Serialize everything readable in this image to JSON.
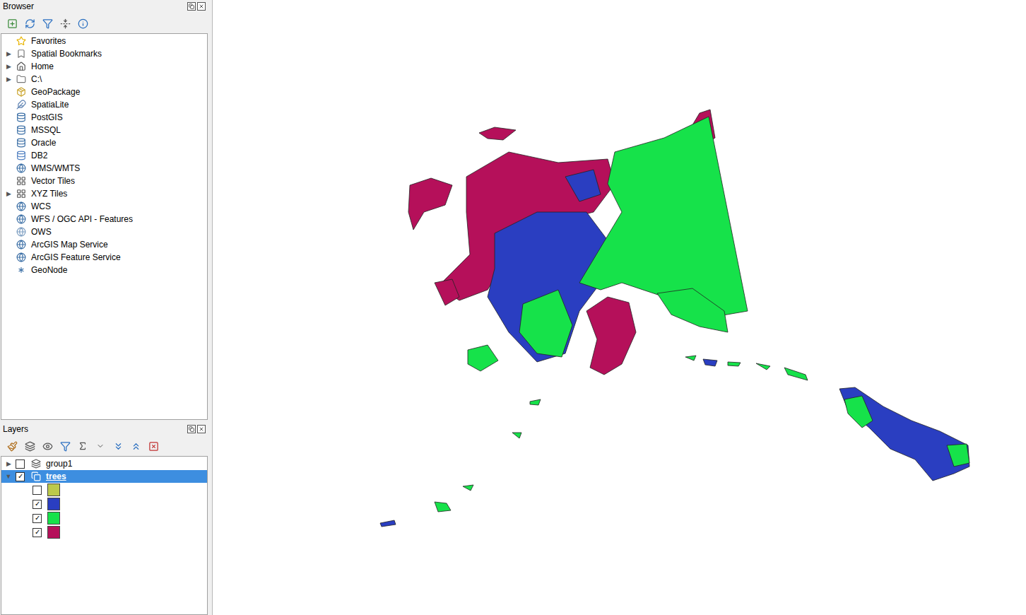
{
  "browser": {
    "title": "Browser",
    "items": [
      {
        "label": "Favorites",
        "expandable": false
      },
      {
        "label": "Spatial Bookmarks",
        "expandable": true
      },
      {
        "label": "Home",
        "expandable": true
      },
      {
        "label": "C:\\",
        "expandable": true
      },
      {
        "label": "GeoPackage",
        "expandable": false
      },
      {
        "label": "SpatiaLite",
        "expandable": false
      },
      {
        "label": "PostGIS",
        "expandable": false
      },
      {
        "label": "MSSQL",
        "expandable": false
      },
      {
        "label": "Oracle",
        "expandable": false
      },
      {
        "label": "DB2",
        "expandable": false
      },
      {
        "label": "WMS/WMTS",
        "expandable": false
      },
      {
        "label": "Vector Tiles",
        "expandable": false
      },
      {
        "label": "XYZ Tiles",
        "expandable": true
      },
      {
        "label": "WCS",
        "expandable": false
      },
      {
        "label": "WFS / OGC API - Features",
        "expandable": false
      },
      {
        "label": "OWS",
        "expandable": false
      },
      {
        "label": "ArcGIS Map Service",
        "expandable": false
      },
      {
        "label": "ArcGIS Feature Service",
        "expandable": false
      },
      {
        "label": "GeoNode",
        "expandable": false
      }
    ]
  },
  "layers_panel": {
    "title": "Layers",
    "layers": [
      {
        "label": "group1",
        "kind": "group",
        "expanded": false,
        "checked": false,
        "selected": false,
        "legend": []
      },
      {
        "label": "trees",
        "kind": "vector",
        "expanded": true,
        "checked": true,
        "selected": true,
        "legend": [
          {
            "checked": false,
            "color": "#bcc94a"
          },
          {
            "checked": true,
            "color": "#2a3ec1"
          },
          {
            "checked": true,
            "color": "#16e24a"
          },
          {
            "checked": true,
            "color": "#b5105a"
          }
        ]
      }
    ]
  }
}
